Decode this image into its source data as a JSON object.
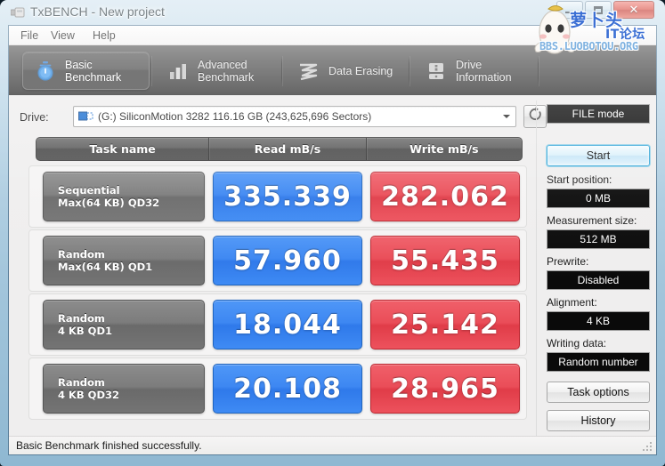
{
  "window": {
    "title": "TxBENCH - New project",
    "icon": "usb-drive-icon",
    "minimize_label": "",
    "maximize_label": "",
    "close_label": "✕"
  },
  "watermark": {
    "cn_line1": "萝卜头",
    "cn_line2": "IT论坛",
    "url": "BBS.LUOBOTOU.ORG",
    "color": "#3b6fd4"
  },
  "menu": {
    "items": [
      {
        "label": "File"
      },
      {
        "label": "View"
      },
      {
        "label": "Help"
      }
    ]
  },
  "tabs": [
    {
      "label_line1": "Basic",
      "label_line2": "Benchmark",
      "icon": "stopwatch-icon",
      "active": true
    },
    {
      "label_line1": "Advanced",
      "label_line2": "Benchmark",
      "icon": "bar-chart-icon",
      "active": false
    },
    {
      "label_line1": "Data Erasing",
      "label_line2": "",
      "icon": "eraser-wave-icon",
      "active": false
    },
    {
      "label_line1": "Drive",
      "label_line2": "Information",
      "icon": "hard-drive-info-icon",
      "active": false
    }
  ],
  "drive": {
    "label": "Drive:",
    "selected": "(G:) SiliconMotion 3282  116.16 GB (243,625,696 Sectors)",
    "refresh_icon": "refresh-icon"
  },
  "results": {
    "headers": {
      "task": "Task name",
      "read": "Read mB/s",
      "write": "Write mB/s"
    },
    "rows": [
      {
        "task_line1": "Sequential",
        "task_line2": "Max(64 KB) QD32",
        "read": "335.339",
        "write": "282.062"
      },
      {
        "task_line1": "Random",
        "task_line2": "Max(64 KB) QD1",
        "read": "57.960",
        "write": "55.435"
      },
      {
        "task_line1": "Random",
        "task_line2": "4 KB QD1",
        "read": "18.044",
        "write": "25.142"
      },
      {
        "task_line1": "Random",
        "task_line2": "4 KB QD32",
        "read": "20.108",
        "write": "28.965"
      }
    ],
    "read_color": "#3d87f2",
    "write_color": "#ea4d58"
  },
  "sidebar": {
    "file_mode": "FILE mode",
    "start_button": "Start",
    "start_position_label": "Start position:",
    "start_position_value": "0 MB",
    "measurement_size_label": "Measurement size:",
    "measurement_size_value": "512 MB",
    "prewrite_label": "Prewrite:",
    "prewrite_value": "Disabled",
    "alignment_label": "Alignment:",
    "alignment_value": "4 KB",
    "writing_data_label": "Writing data:",
    "writing_data_value": "Random number",
    "task_options_button": "Task options",
    "history_button": "History"
  },
  "status": {
    "message": "Basic Benchmark finished successfully."
  }
}
